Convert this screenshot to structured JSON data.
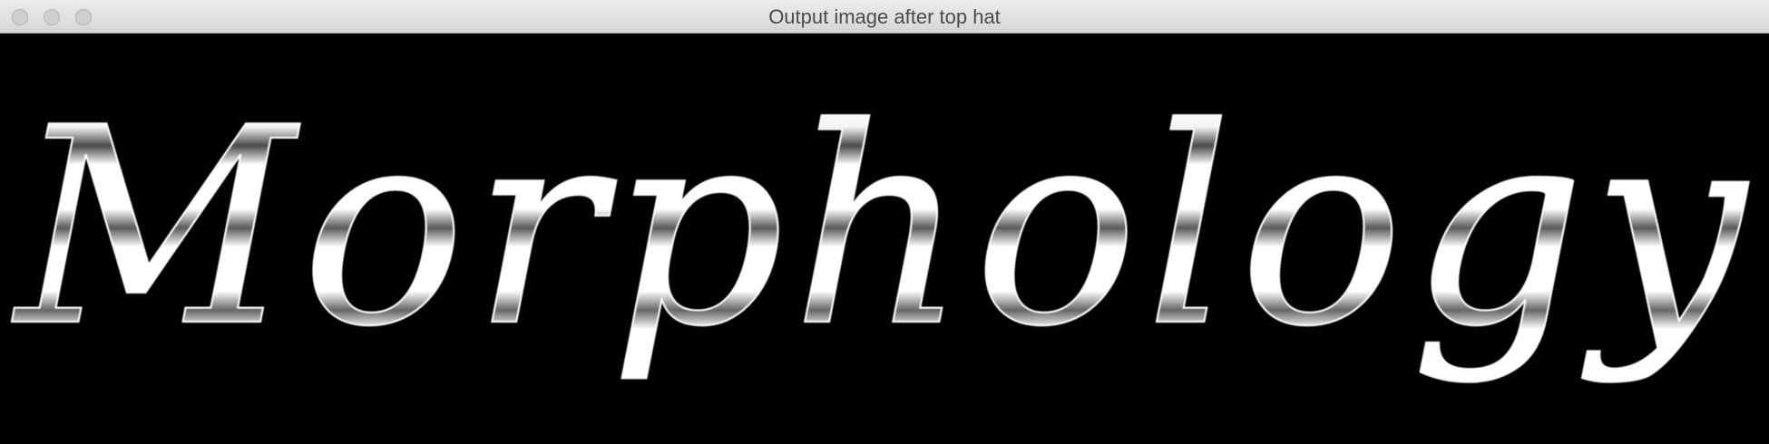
{
  "window": {
    "title": "Output image after top hat"
  },
  "image": {
    "text": "Morphology",
    "background_color": "#000000",
    "foreground_color": "#ffffff"
  },
  "icons": {
    "close": "close-button",
    "minimize": "minimize-button",
    "zoom": "zoom-button"
  }
}
